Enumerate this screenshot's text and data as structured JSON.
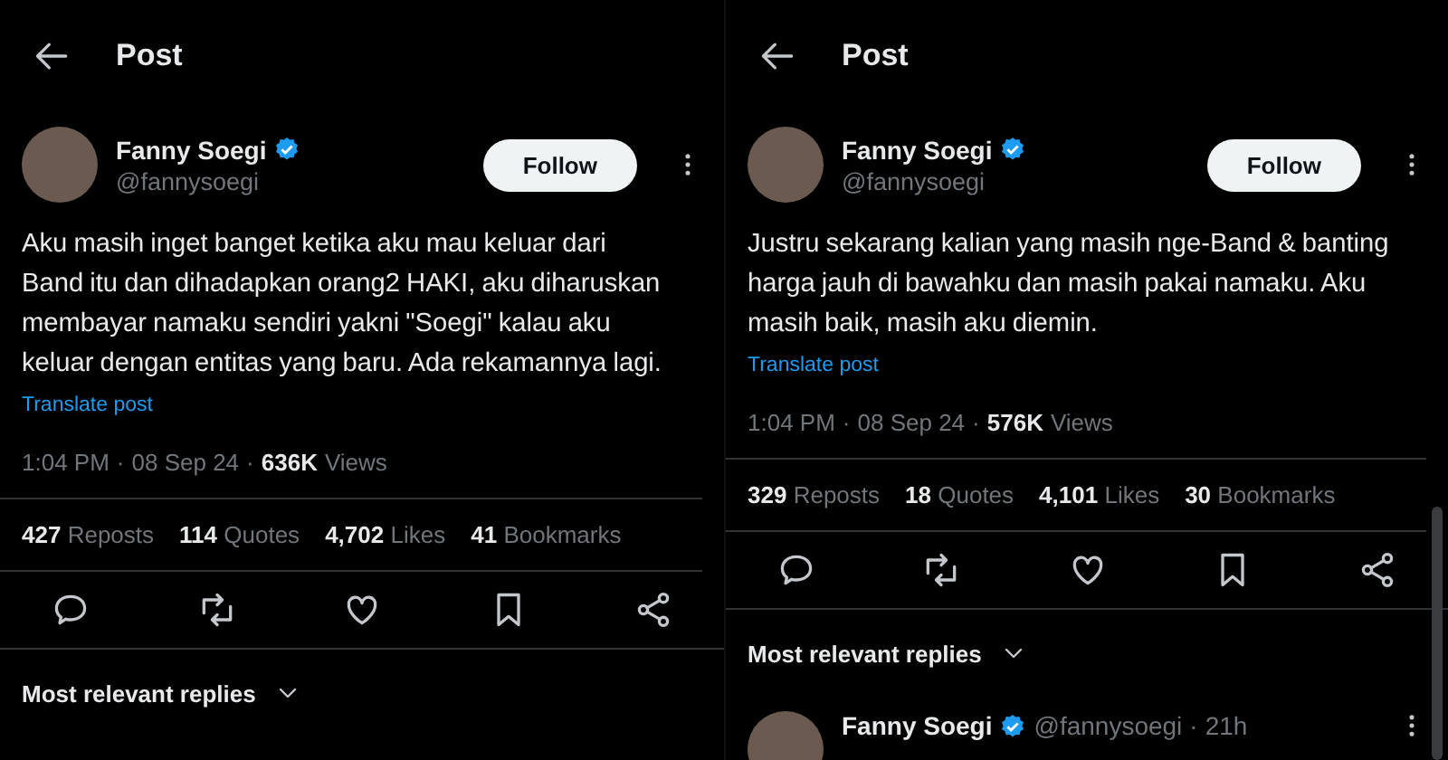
{
  "panels": [
    {
      "header": {
        "title": "Post"
      },
      "author": {
        "name": "Fanny Soegi",
        "handle": "@fannysoegi"
      },
      "follow": "Follow",
      "text": "Aku masih inget banget ketika aku mau keluar dari Band itu dan dihadapkan orang2 HAKI, aku diharuskan membayar namaku sendiri yakni \"Soegi\" kalau aku keluar dengan entitas yang baru. Ada rekamannya lagi.",
      "translate": "Translate post",
      "time": "1:04 PM",
      "separator": "·",
      "date": "08 Sep 24",
      "views_count": "636K",
      "views_label": "Views",
      "stats": [
        {
          "count": "427",
          "label": "Reposts"
        },
        {
          "count": "114",
          "label": "Quotes"
        },
        {
          "count": "4,702",
          "label": "Likes"
        },
        {
          "count": "41",
          "label": "Bookmarks"
        }
      ],
      "replies_sort": "Most relevant replies"
    },
    {
      "header": {
        "title": "Post"
      },
      "author": {
        "name": "Fanny Soegi",
        "handle": "@fannysoegi"
      },
      "follow": "Follow",
      "text": "Justru sekarang kalian yang masih nge-Band & banting harga jauh di bawahku dan masih pakai namaku. Aku masih baik, masih aku diemin.",
      "translate": "Translate post",
      "time": "1:04 PM",
      "separator": "·",
      "date": "08 Sep 24",
      "views_count": "576K",
      "views_label": "Views",
      "stats": [
        {
          "count": "329",
          "label": "Reposts"
        },
        {
          "count": "18",
          "label": "Quotes"
        },
        {
          "count": "4,101",
          "label": "Likes"
        },
        {
          "count": "30",
          "label": "Bookmarks"
        }
      ],
      "replies_sort": "Most relevant replies",
      "reply": {
        "name": "Fanny Soegi",
        "handle": "@fannysoegi",
        "separator": "·",
        "age": "21h"
      }
    }
  ]
}
